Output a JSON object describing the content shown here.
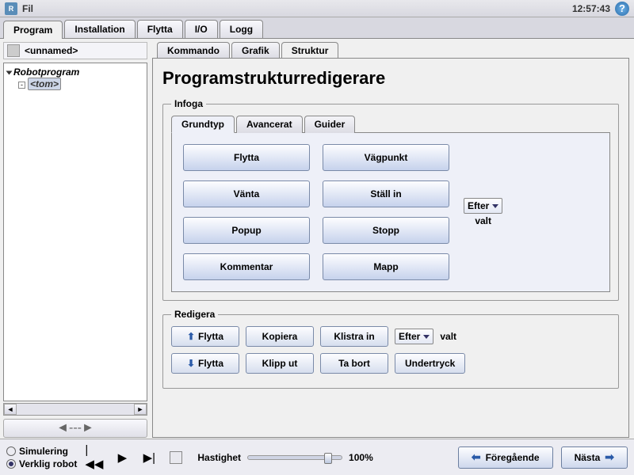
{
  "titlebar": {
    "menu": "Fil",
    "clock": "12:57:43"
  },
  "maintabs": [
    "Program",
    "Installation",
    "Flytta",
    "I/O",
    "Logg"
  ],
  "maintab_active": 0,
  "file": {
    "name": "<unnamed>"
  },
  "tree": {
    "root": "Robotprogram",
    "child": "<tom>"
  },
  "subtabs": [
    "Kommando",
    "Grafik",
    "Struktur"
  ],
  "subtab_active": 2,
  "editor_title": "Programstrukturredigerare",
  "insert": {
    "legend": "Infoga",
    "tabs": [
      "Grundtyp",
      "Avancerat",
      "Guider"
    ],
    "tab_active": 0,
    "buttons": [
      "Flytta",
      "Vägpunkt",
      "Vänta",
      "Ställ in",
      "Popup",
      "Stopp",
      "Kommentar",
      "Mapp"
    ],
    "side_select": "Efter",
    "side_label": "valt"
  },
  "edit": {
    "legend": "Redigera",
    "row1": [
      "Flytta",
      "Kopiera",
      "Klistra in"
    ],
    "row1_sel": "Efter",
    "row1_sel_label": "valt",
    "row2": [
      "Flytta",
      "Klipp ut",
      "Ta bort",
      "Undertryck"
    ]
  },
  "bottom": {
    "sim": "Simulering",
    "real": "Verklig robot",
    "speed_label": "Hastighet",
    "speed_value": "100%",
    "prev": "Föregående",
    "next": "Nästa"
  }
}
